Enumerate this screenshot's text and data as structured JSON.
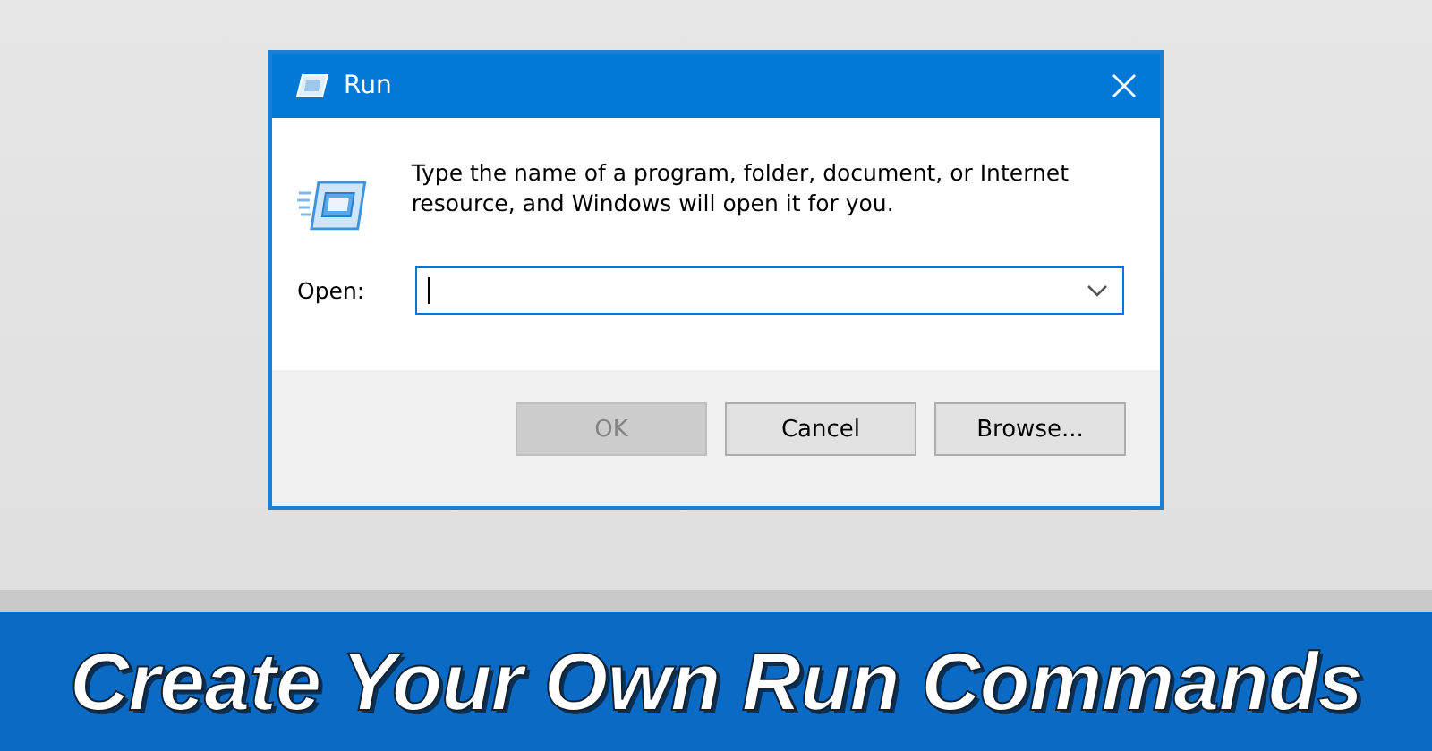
{
  "window": {
    "title": "Run"
  },
  "message": "Type the name of a program, folder, document, or Internet resource, and Windows will open it for you.",
  "open_field": {
    "label": "Open:"
  },
  "buttons": [
    {
      "label": "OK",
      "disabled": true
    },
    {
      "label": "Cancel",
      "disabled": false
    },
    {
      "label": "Browse...",
      "disabled": false
    }
  ],
  "banner": {
    "headline": "Create Your Own Run Commands"
  }
}
